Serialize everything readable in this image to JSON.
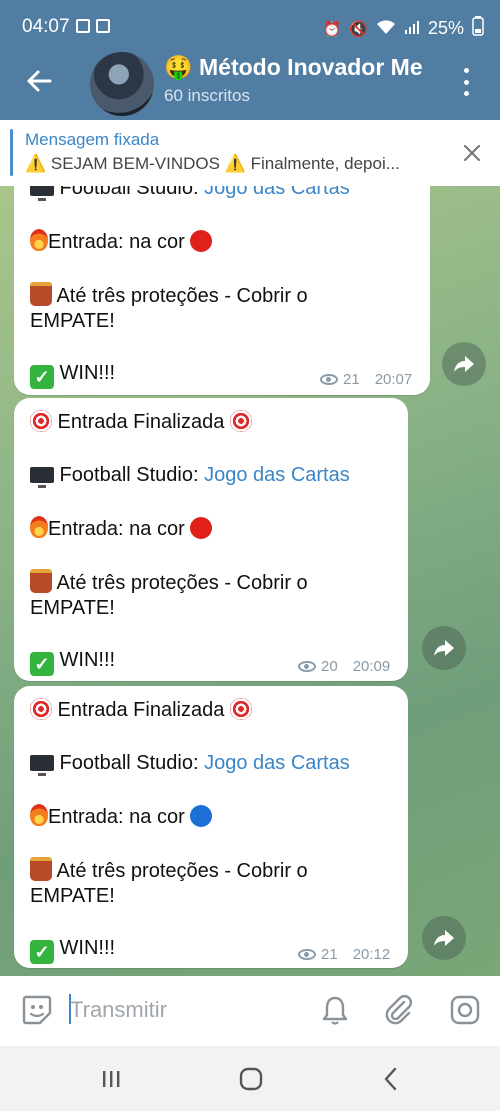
{
  "status_bar": {
    "time": "04:07",
    "battery": "25%"
  },
  "header": {
    "title": "🤑 Método Inovador Me",
    "subtitle": "60 inscritos"
  },
  "pinned": {
    "title": "Mensagem fixada",
    "text": "⚠️ SEJAM BEM-VINDOS ⚠️  Finalmente, depoi..."
  },
  "messages": [
    {
      "line_game_prefix": " Football Studio: ",
      "line_game_link": "Jogo das Cartas",
      "line_entry": "Entrada: na cor ",
      "line_protect_1": " Até três proteções - Cobrir o",
      "line_protect_2": "EMPATE!",
      "line_result": " WIN!!!",
      "views": "21",
      "time": "20:07",
      "color": "red"
    },
    {
      "line_title": " Entrada Finalizada ",
      "line_game_prefix": " Football Studio: ",
      "line_game_link": "Jogo das Cartas",
      "line_entry": "Entrada: na cor ",
      "line_protect_1": " Até três proteções - Cobrir o",
      "line_protect_2": "EMPATE!",
      "line_result": " WIN!!!",
      "views": "20",
      "time": "20:09",
      "color": "red"
    },
    {
      "line_title": " Entrada Finalizada ",
      "line_game_prefix": " Football Studio: ",
      "line_game_link": "Jogo das Cartas",
      "line_entry": "Entrada: na cor ",
      "line_protect_1": " Até três proteções - Cobrir o",
      "line_protect_2": "EMPATE!",
      "line_result": " WIN!!!",
      "views": "21",
      "time": "20:12",
      "color": "blue"
    }
  ],
  "input": {
    "placeholder": "Transmitir"
  },
  "colors": {
    "header": "#517da2",
    "link": "#3a86c8",
    "win_check": "#34b33e"
  },
  "icons": [
    "back-arrow-icon",
    "more-vertical-icon",
    "close-icon",
    "eye-icon",
    "forward-icon",
    "sticker-icon",
    "bell-icon",
    "paperclip-icon",
    "camera-icon",
    "recents-icon",
    "home-icon",
    "back-icon"
  ]
}
